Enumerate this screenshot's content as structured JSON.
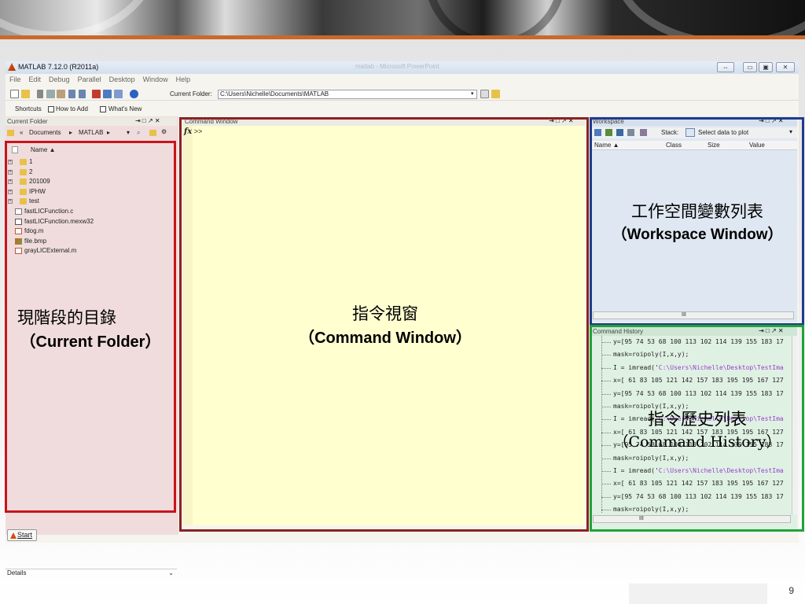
{
  "slide": {
    "page_number": "9",
    "colors": {
      "accent_line": "#c96a2a"
    }
  },
  "window": {
    "title": "MATLAB  7.12.0 (R2011a)",
    "ghost_title": "matlab - Microsoft PowerPoint",
    "controls": [
      "⇔",
      "▭",
      "▣",
      "✕"
    ]
  },
  "menu": [
    "File",
    "Edit",
    "Debug",
    "Parallel",
    "Desktop",
    "Window",
    "Help"
  ],
  "toolbar": {
    "current_folder_label": "Current Folder:",
    "current_folder_path": "C:\\Users\\Nichelle\\Documents\\MATLAB",
    "icons": [
      "new-file-icon",
      "open-icon",
      "cut-icon",
      "copy-icon",
      "paste-icon",
      "undo-icon",
      "redo-icon",
      "simulink-icon",
      "guide-icon",
      "profiler-icon",
      "help-icon"
    ]
  },
  "shortcuts": {
    "shortcuts": "Shortcuts",
    "how_to_add": "How to Add",
    "whats_new": "What's New"
  },
  "current_folder": {
    "title": "Current Folder",
    "controls": "⇥ □ ↗ ✕",
    "breadcrumb": [
      "«",
      "Documents",
      "▸",
      "MATLAB",
      "▸"
    ],
    "column_name": "Name ▲",
    "items": [
      {
        "name": "1",
        "kind": "folder",
        "expandable": true
      },
      {
        "name": "2",
        "kind": "folder",
        "expandable": true
      },
      {
        "name": "201009",
        "kind": "folder",
        "expandable": true
      },
      {
        "name": "IPHW",
        "kind": "folder",
        "expandable": true
      },
      {
        "name": "test",
        "kind": "folder",
        "expandable": true
      },
      {
        "name": "fastLICFunction.c",
        "kind": "c",
        "expandable": false
      },
      {
        "name": "fastLICFunction.mexw32",
        "kind": "mex",
        "expandable": false
      },
      {
        "name": "fdog.m",
        "kind": "m",
        "expandable": false
      },
      {
        "name": "file.bmp",
        "kind": "bmp",
        "expandable": false
      },
      {
        "name": "grayLICExternal.m",
        "kind": "m",
        "expandable": false
      }
    ],
    "details": "Details",
    "details_icon": "chevron-down-icon"
  },
  "command_window": {
    "title": "Command Window",
    "controls": "⇥ □ ↗ ✕",
    "fx": "fx",
    "prompt": ">>"
  },
  "workspace": {
    "title": "Workspace",
    "controls": "⇥ □ ↗ ✕",
    "stack_label": "Stack:",
    "select_plot": "Select data to plot",
    "columns": [
      "Name ▲",
      "Class",
      "Size",
      "Value"
    ],
    "scroll": "III"
  },
  "command_history": {
    "title": "Command History",
    "controls": "⇥ □ ↗ ✕",
    "lines": [
      {
        "text": "y=[95 74 53 68 100 113 102 114 139 155 183 17"
      },
      {
        "text": "mask=roipoly(I,x,y);"
      },
      {
        "text": "I = imread('",
        "str": "C:\\Users\\Nichelle\\Desktop\\TestIma"
      },
      {
        "text": "x=[ 61 83 105 121 142 157 183 195 195 167 127"
      },
      {
        "text": "y=[95 74 53 68 100 113 102 114 139 155 183 17"
      },
      {
        "text": "mask=roipoly(I,x,y);"
      },
      {
        "text": "I = imread('",
        "str": "C:\\Users\\Nichelle\\Desktop\\TestIma"
      },
      {
        "text": "x=[ 61 83 105 121 142 157 183 195 195 167 127"
      },
      {
        "text": "y=[95 74 53 68 100 113 102 114 139 155 183 17"
      },
      {
        "text": "mask=roipoly(I,x,y);"
      },
      {
        "text": "I = imread('",
        "str": "C:\\Users\\Nichelle\\Desktop\\TestIma"
      },
      {
        "text": "x=[ 61 83 105 121 142 157 183 195 195 167 127"
      },
      {
        "text": "y=[95 74 53 68 100 113 102 114 139 155 183 17"
      },
      {
        "text": "mask=roipoly(I,x,y);"
      }
    ],
    "scroll": "III"
  },
  "start": {
    "label": "Start"
  },
  "annotations": {
    "current_folder": {
      "zh": "現階段的目錄",
      "en": "（Current Folder）",
      "color": "#c8141c"
    },
    "command_window": {
      "zh": "指令視窗",
      "en": "（Command Window）",
      "color": "#8b2220"
    },
    "workspace": {
      "zh": "工作空間變數列表",
      "en": "（Workspace Window）",
      "color": "#1e3c8c"
    },
    "command_history": {
      "zh": "指令歷史列表",
      "en": "（Command History）",
      "color": "#1fa33a"
    }
  }
}
